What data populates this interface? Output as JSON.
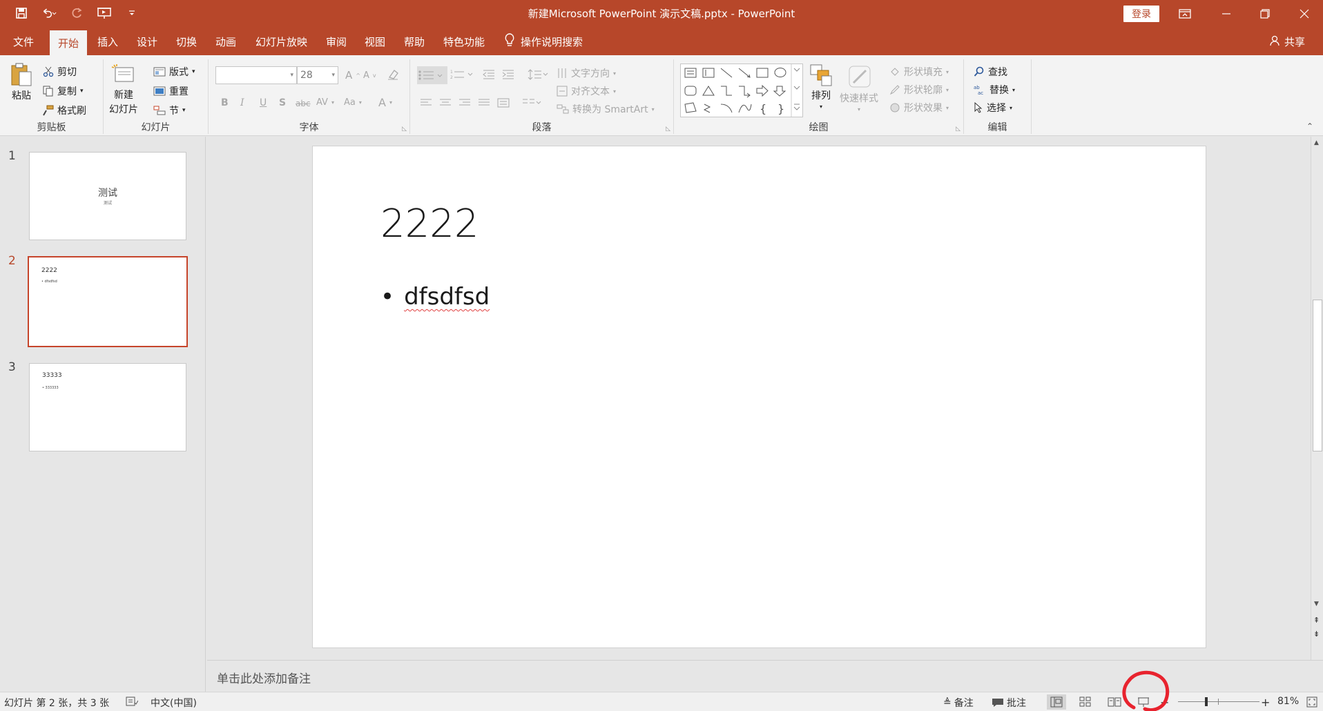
{
  "titlebar": {
    "title": "新建Microsoft PowerPoint 演示文稿.pptx  -  PowerPoint",
    "login_label": "登录",
    "qat_icons": [
      "save-icon",
      "undo-icon",
      "redo-icon",
      "slideshow-from-start-icon",
      "customize-qat-icon"
    ],
    "window_controls": [
      "ribbon-display-options-icon",
      "minimize-icon",
      "restore-icon",
      "close-icon"
    ]
  },
  "tabs": {
    "items": [
      "文件",
      "开始",
      "插入",
      "设计",
      "切换",
      "动画",
      "幻灯片放映",
      "审阅",
      "视图",
      "帮助",
      "特色功能"
    ],
    "active": "开始",
    "tell_me": "操作说明搜索",
    "share": "共享"
  },
  "ribbon": {
    "clipboard": {
      "paste": "粘贴",
      "cut": "剪切",
      "copy": "复制",
      "format_painter": "格式刷",
      "label": "剪贴板"
    },
    "slides": {
      "new_slide_line1": "新建",
      "new_slide_line2": "幻灯片",
      "layout": "版式",
      "reset": "重置",
      "section": "节",
      "label": "幻灯片"
    },
    "font": {
      "font_name": "",
      "font_size": "28",
      "label": "字体",
      "buttons": [
        "B",
        "I",
        "U",
        "S",
        "abc",
        "AV",
        "Aa",
        "A"
      ]
    },
    "paragraph": {
      "text_direction": "文字方向",
      "align_text": "对齐文本",
      "convert_smartart": "转换为 SmartArt",
      "label": "段落"
    },
    "drawing": {
      "arrange": "排列",
      "quick_styles": "快速样式",
      "shape_fill": "形状填充",
      "shape_outline": "形状轮廓",
      "shape_effects": "形状效果",
      "label": "绘图"
    },
    "editing": {
      "find": "查找",
      "replace": "替换",
      "select": "选择",
      "label": "编辑"
    }
  },
  "slides": [
    {
      "number": "1",
      "title": "测试",
      "subtitle": "测试"
    },
    {
      "number": "2",
      "title": "2222",
      "bullet": "• dfsdfsd"
    },
    {
      "number": "3",
      "title": "33333",
      "bullet": "• 333333"
    }
  ],
  "current_slide": {
    "title": "2222",
    "bullet_char": "•",
    "bullet": "dfsdfsd"
  },
  "notes": {
    "placeholder": "单击此处添加备注"
  },
  "statusbar": {
    "slide_info": "幻灯片 第 2 张，共 3 张",
    "language": "中文(中国)",
    "notes_label": "备注",
    "comments_label": "批注",
    "zoom_percent": "81%",
    "zoom_minus": "−",
    "zoom_plus": "+",
    "zoom_level": 0.81
  },
  "colors": {
    "accent": "#b7472a",
    "selected_thumb_border": "#c6442a",
    "annotation_circle": "#e8232e"
  }
}
